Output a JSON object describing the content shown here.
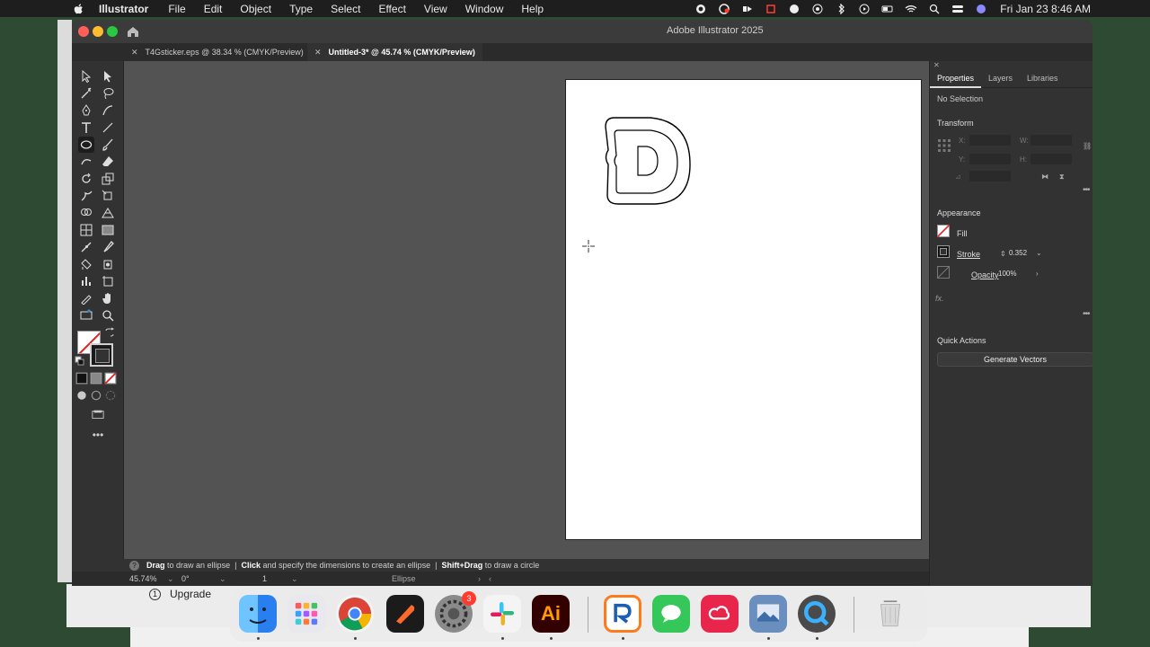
{
  "menubar": {
    "app_name": "Illustrator",
    "menus": [
      "File",
      "Edit",
      "Object",
      "Type",
      "Select",
      "Effect",
      "View",
      "Window",
      "Help"
    ],
    "clock": "Fri Jan 23  8:46 AM"
  },
  "window": {
    "title": "Adobe Illustrator 2025",
    "tabs": [
      {
        "label": "T4Gsticker.eps @ 38.34 % (CMYK/Preview)",
        "active": false
      },
      {
        "label": "Untitled-3* @ 45.74 % (CMYK/Preview)",
        "active": true
      }
    ]
  },
  "artwork": {
    "letter": "D"
  },
  "panel": {
    "tabs": [
      "Properties",
      "Layers",
      "Libraries"
    ],
    "selection": "No Selection",
    "transform": {
      "title": "Transform",
      "x_label": "X:",
      "y_label": "Y:",
      "w_label": "W:",
      "h_label": "H:"
    },
    "appearance": {
      "title": "Appearance",
      "fill_label": "Fill",
      "stroke_label": "Stroke",
      "stroke_value": "0.352",
      "opacity_label": "Opacity",
      "opacity_value": "100%",
      "fx_label": "fx."
    },
    "quick_actions": {
      "title": "Quick Actions",
      "generate_vectors": "Generate Vectors"
    }
  },
  "hint": {
    "drag": "Drag",
    "drag_text": "to draw an ellipse",
    "click": "Click",
    "click_text": "and specify the dimensions to create an ellipse",
    "shift": "Shift+Drag",
    "shift_text": "to draw a circle",
    "sep": "|"
  },
  "status": {
    "zoom": "45.74%",
    "rotation": "0°",
    "artboard": "1",
    "tool": "Ellipse"
  },
  "upgrade": {
    "num": "1",
    "label": "Upgrade"
  },
  "dock": {
    "badge_count": "3",
    "ai_label": "Ai"
  },
  "colors": {
    "illustrator": "#ff9a00",
    "illustrator_bg": "#330000",
    "slash": "#e02020"
  }
}
